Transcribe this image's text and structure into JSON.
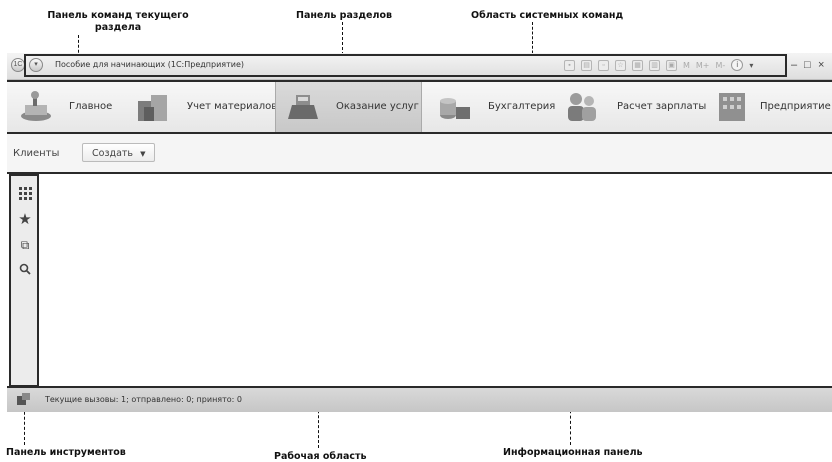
{
  "annotations": {
    "command_panel": "Панель команд текущего\nраздела",
    "sections_panel": "Панель разделов",
    "system_commands": "Область системных команд",
    "tools_panel": "Панель инструментов",
    "work_area": "Рабочая область",
    "info_panel": "Информационная панель"
  },
  "window": {
    "title": "Пособие для начинающих  (1С:Предприятие)",
    "system_buttons": [
      "M",
      "M+",
      "M-"
    ],
    "controls": [
      "–",
      "□",
      "×"
    ]
  },
  "sections": [
    {
      "label": "Главное",
      "icon": "main-icon",
      "active": false
    },
    {
      "label": "Учет материалов",
      "icon": "materials-icon",
      "active": false
    },
    {
      "label": "Оказание услуг",
      "icon": "cash-register-icon",
      "active": true
    },
    {
      "label": "Бухгалтерия",
      "icon": "accounting-icon",
      "active": false
    },
    {
      "label": "Расчет зарплаты",
      "icon": "people-icon",
      "active": false
    },
    {
      "label": "Предприятие",
      "icon": "building-icon",
      "active": false
    }
  ],
  "commands": {
    "clients": "Клиенты",
    "create": "Создать"
  },
  "tools": [
    "apps-grid-icon",
    "star-icon",
    "history-icon",
    "search-icon"
  ],
  "info": {
    "text": "Текущие вызовы: 1; отправлено: 0; принято: 0"
  }
}
